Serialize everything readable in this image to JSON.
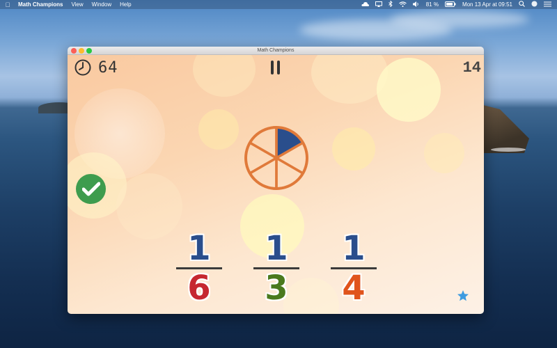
{
  "menubar": {
    "app_name": "Math Champions",
    "items": [
      "View",
      "Window",
      "Help"
    ],
    "battery": "81 %",
    "datetime": "Mon 13 Apr at  09:51"
  },
  "window": {
    "title": "Math Champions"
  },
  "game": {
    "timer": "64",
    "score": "14",
    "pie": {
      "total_slices": 6,
      "shaded_slices": 1,
      "shaded_color": "#2a4e8c",
      "outline_color": "#e07a3a"
    },
    "fractions": [
      {
        "numerator": "1",
        "denominator": "6",
        "denominator_color": "#c62730",
        "numerator_color": "#2a4e8c"
      },
      {
        "numerator": "1",
        "denominator": "3",
        "denominator_color": "#4a7a1e",
        "numerator_color": "#2a4e8c"
      },
      {
        "numerator": "1",
        "denominator": "4",
        "denominator_color": "#e0541c",
        "numerator_color": "#2a4e8c"
      }
    ],
    "check_color": "#3e9c4e",
    "star_color": "#3d9be0"
  },
  "icons": {
    "timer": "clock-icon",
    "pause": "pause-icon",
    "check": "check-icon",
    "star": "star-icon"
  }
}
